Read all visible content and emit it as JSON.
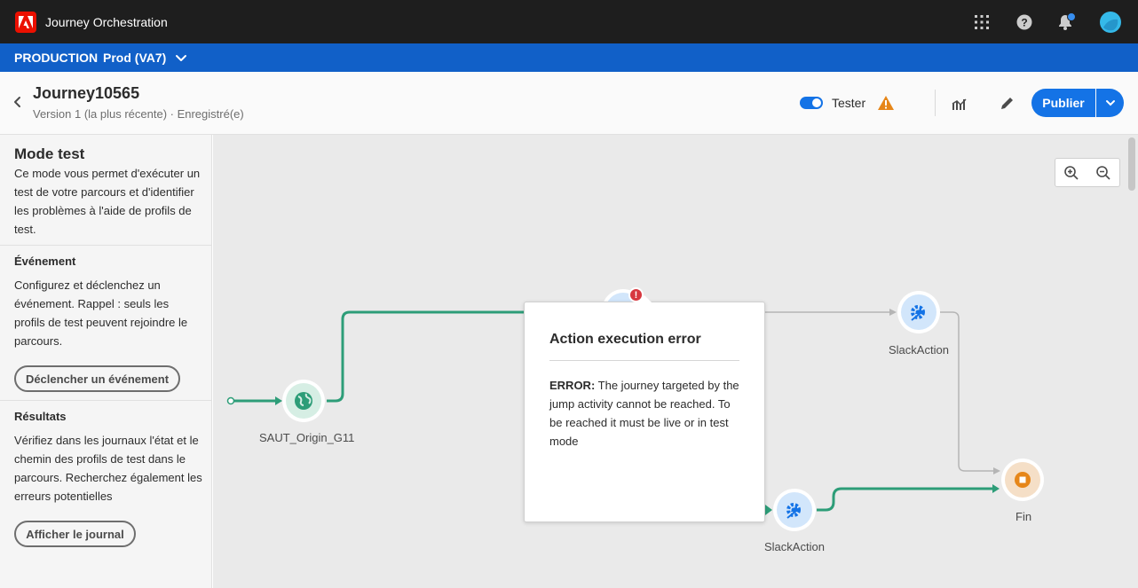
{
  "app": {
    "title": "Journey Orchestration",
    "logo_letter": "A"
  },
  "env": {
    "environment": "PRODUCTION",
    "sandbox": "Prod (VA7)"
  },
  "header": {
    "journey_name": "Journey10565",
    "version_text": "Version 1 (la plus récente) · Enregistré(e)",
    "test_toggle_label": "Tester",
    "test_toggle_on": true,
    "publish_label": "Publier"
  },
  "left_panel": {
    "mode_title": "Mode test",
    "mode_desc": "Ce mode vous permet d'exécuter un test de votre parcours et d'identifier les problèmes à l'aide de profils de test.",
    "event_title": "Événement",
    "event_desc": "Configurez et déclenchez un événement. Rappel : seuls les profils de test peuvent rejoindre le parcours.",
    "event_button": "Déclencher un événement",
    "results_title": "Résultats",
    "results_desc": "Vérifiez dans les journaux l'état et le chemin des profils de test dans le parcours. Recherchez également les erreurs potentielles",
    "results_button": "Afficher le journal"
  },
  "canvas": {
    "nodes": [
      {
        "label": "SAUT_Origin_G11",
        "kind": "jump",
        "icon": "globe-icon"
      },
      {
        "label": "SlackAction",
        "kind": "action",
        "icon": "action-gear-icon"
      },
      {
        "label": "SlackAction",
        "kind": "action",
        "icon": "action-gear-icon"
      },
      {
        "label": "Fin",
        "kind": "end",
        "icon": "stop-icon"
      }
    ],
    "error_badge": "!"
  },
  "popover": {
    "title": "Action execution error",
    "error_prefix": "ERROR:",
    "error_message": "The journey targeted by the jump activity cannot be reached. To be reached it must be live or in test mode"
  },
  "colors": {
    "topbar": "#1e1e1e",
    "envbar": "#1160c8",
    "accent": "#1473e6",
    "path_green": "#2d9d78",
    "error_red": "#d7373f",
    "warning_orange": "#e68619",
    "end_orange": "#f5dfc7"
  }
}
